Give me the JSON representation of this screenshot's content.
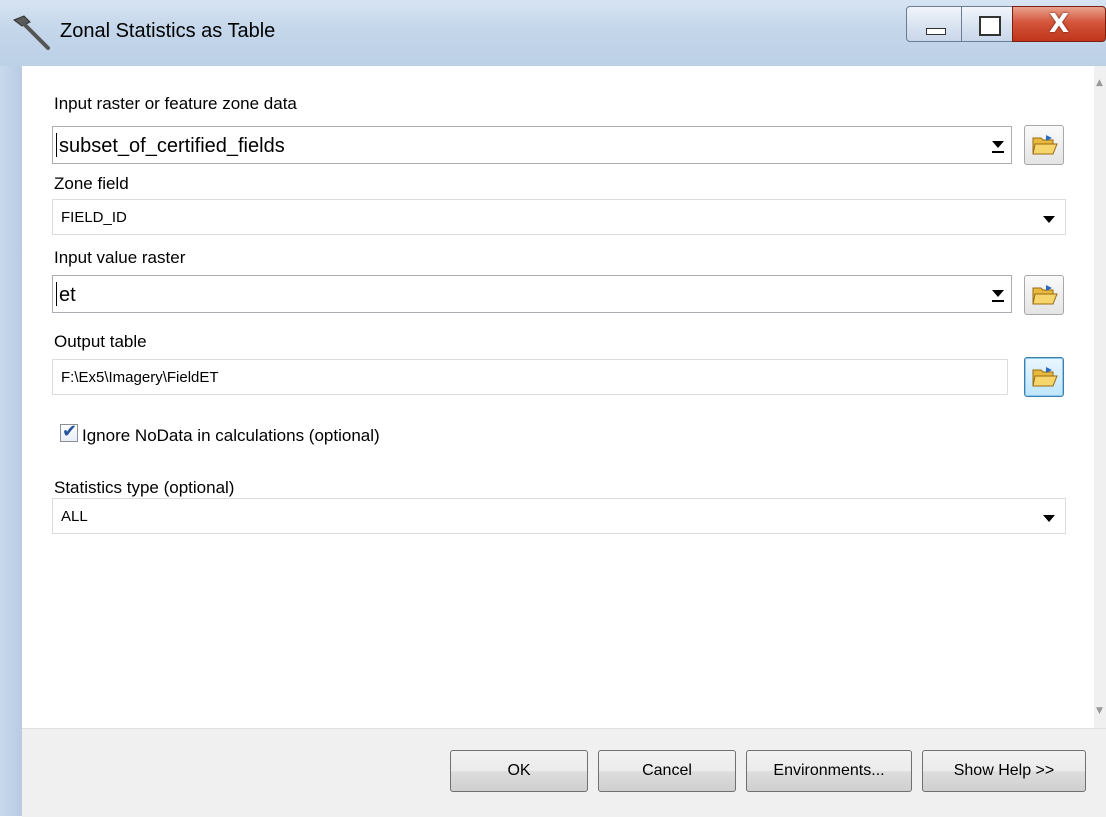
{
  "window": {
    "title": "Zonal Statistics as Table",
    "close_glyph": "X"
  },
  "form": {
    "input_zone": {
      "label": "Input raster or feature zone data",
      "value": "subset_of_certified_fields"
    },
    "zone_field": {
      "label": "Zone field",
      "value": "FIELD_ID"
    },
    "input_value_raster": {
      "label": "Input value raster",
      "value": "et"
    },
    "output_table": {
      "label": "Output table",
      "value": "F:\\Ex5\\Imagery\\FieldET"
    },
    "ignore_nodata": {
      "label": "Ignore NoData in calculations (optional)",
      "checked": true
    },
    "statistics_type": {
      "label": "Statistics type (optional)",
      "value": "ALL"
    }
  },
  "buttons": {
    "ok": "OK",
    "cancel": "Cancel",
    "environments": "Environments...",
    "show_help": "Show Help >>"
  },
  "icons": {
    "title": "hammer-icon",
    "browse": "open-folder-icon",
    "checkbox_mark": "✔"
  },
  "colors": {
    "titlebar": "#c4d6ea",
    "close_button": "#c0361b",
    "focus_border": "#3c7fb1"
  }
}
